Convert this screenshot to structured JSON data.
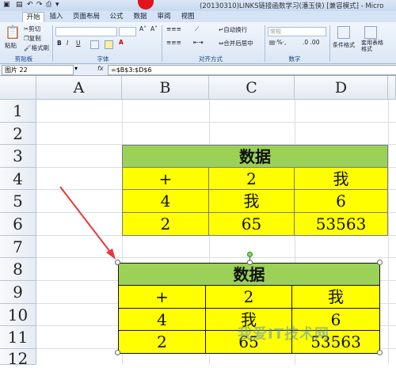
{
  "title_bar": {
    "title": "(20130310)LINKS链接函数学习(潘玉侠) [兼容模式] - Micro"
  },
  "tabs": [
    "开始",
    "插入",
    "页面布局",
    "公式",
    "数据",
    "审阅",
    "视图"
  ],
  "ribbon": {
    "clipboard": {
      "paste": "粘贴",
      "cut": "剪切",
      "copy": "复制",
      "format_painter": "格式刷",
      "label": "剪贴板"
    },
    "font": {
      "label": "字体"
    },
    "alignment": {
      "wrap": "自动换行",
      "merge": "合并后居中",
      "label": "对齐方式"
    },
    "number": {
      "format": "常规",
      "label": "数字"
    },
    "styles": {
      "conditional": "条件格式",
      "table": "套用表格格式"
    }
  },
  "formula_bar": {
    "name_box": "图片 22",
    "fx": "fx",
    "formula": "=$B$3:$D$6"
  },
  "columns": [
    "A",
    "B",
    "C",
    "D"
  ],
  "rows": [
    "1",
    "2",
    "3",
    "4",
    "5",
    "6",
    "7",
    "8",
    "9",
    "10",
    "11",
    "12"
  ],
  "table1": {
    "header": "数据",
    "rows": [
      [
        "+",
        "2",
        "我"
      ],
      [
        "4",
        "我",
        "6"
      ],
      [
        "2",
        "65",
        "53563"
      ]
    ]
  },
  "table2": {
    "header": "数据",
    "rows": [
      [
        "+",
        "2",
        "我"
      ],
      [
        "4",
        "我",
        "6"
      ],
      [
        "2",
        "65",
        "53563"
      ]
    ]
  },
  "watermark": "我爱IT技术网",
  "colors": {
    "header_green": "#9bd157",
    "cell_yellow": "#ffff00",
    "arrow_red": "#e8373c"
  }
}
